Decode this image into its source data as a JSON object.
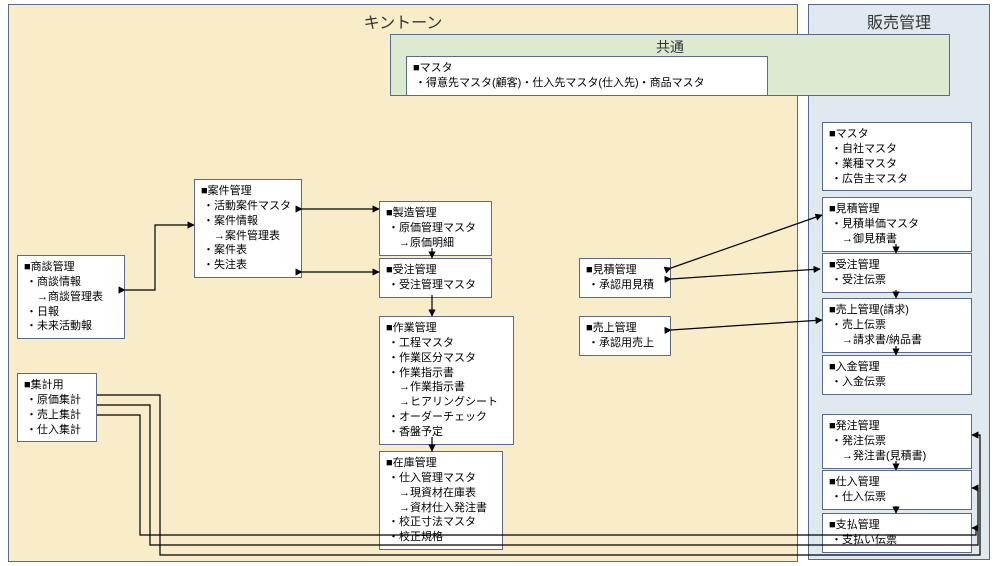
{
  "regions": {
    "kintone": "キントーン",
    "sales": "販売管理",
    "common": "共通"
  },
  "common_box": {
    "title": "■マスタ",
    "items": [
      "・得意先マスタ(顧客)・仕入先マスタ(仕入先)・商品マスタ"
    ]
  },
  "kintone": {
    "negotiation": {
      "title": "■商談管理",
      "items": [
        "・商談情報",
        "　→商談管理表",
        "・日報",
        "・未来活動報"
      ]
    },
    "aggregation": {
      "title": "■集計用",
      "items": [
        "・原価集計",
        "・売上集計",
        "・仕入集計"
      ]
    },
    "project": {
      "title": "■案件管理",
      "items": [
        "・活動案件マスタ",
        "・案件情報",
        "　→案件管理表",
        "・案件表",
        "・失注表"
      ]
    },
    "manufacture": {
      "title": "■製造管理",
      "items": [
        "・原価管理マスタ",
        "　→原価明細"
      ]
    },
    "order_recv": {
      "title": "■受注管理",
      "items": [
        "・受注管理マスタ"
      ]
    },
    "work": {
      "title": "■作業管理",
      "items": [
        "・工程マスタ",
        "・作業区分マスタ",
        "・作業指示書",
        "　→作業指示書",
        "　→ヒアリングシート",
        "・オーダーチェック",
        "・香盤予定"
      ]
    },
    "stock": {
      "title": "■在庫管理",
      "items": [
        "・仕入管理マスタ",
        "　→現資材在庫表",
        "　→資材仕入発注書",
        "・校正寸法マスタ",
        "・校正規格"
      ]
    },
    "estimate": {
      "title": "■見積管理",
      "items": [
        "・承認用見積"
      ]
    },
    "sales": {
      "title": "■売上管理",
      "items": [
        "・承認用売上"
      ]
    }
  },
  "sales_panel": {
    "master": {
      "title": "■マスタ",
      "items": [
        "・自社マスタ",
        "・業種マスタ",
        "・広告主マスタ"
      ]
    },
    "estimate": {
      "title": "■見積管理",
      "items": [
        "・見積単価マスタ",
        "　→御見積書"
      ]
    },
    "order_recv": {
      "title": "■受注管理",
      "items": [
        "・受注伝票"
      ]
    },
    "sales": {
      "title": "■売上管理(請求)",
      "items": [
        "・売上伝票",
        "　→請求書/納品書"
      ]
    },
    "deposit": {
      "title": "■入金管理",
      "items": [
        "・入金伝票"
      ]
    },
    "purchase_order": {
      "title": "■発注管理",
      "items": [
        "・発注伝票",
        "　→発注書(見積書)"
      ]
    },
    "purchase": {
      "title": "■仕入管理",
      "items": [
        "・仕入伝票"
      ]
    },
    "payment": {
      "title": "■支払管理",
      "items": [
        "・支払い伝票"
      ]
    }
  }
}
